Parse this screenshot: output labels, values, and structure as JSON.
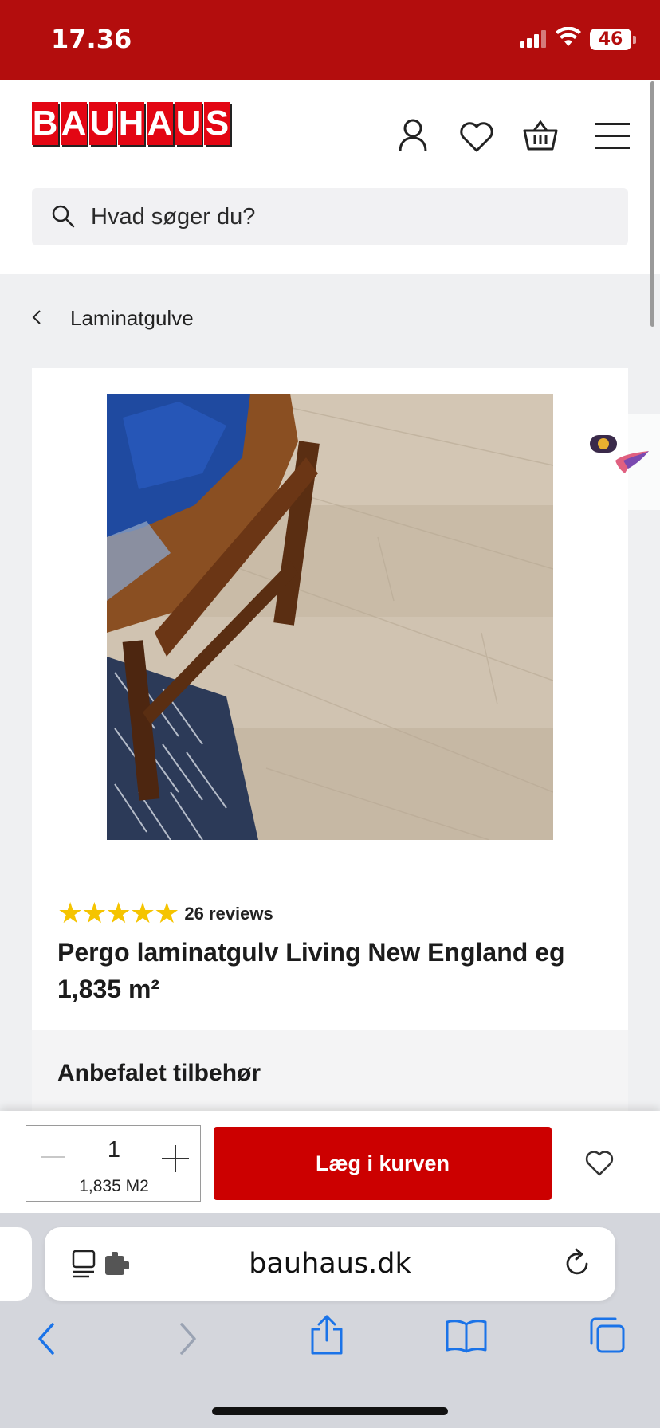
{
  "status_bar": {
    "time": "17.36",
    "battery": "46"
  },
  "header": {
    "logo_text": "BAUHAUS",
    "logo_letters": [
      "B",
      "A",
      "U",
      "H",
      "A",
      "U",
      "S"
    ],
    "icons": [
      "account-icon",
      "heart-icon",
      "basket-icon",
      "menu-icon"
    ],
    "search": {
      "placeholder": "Hvad søger du?"
    }
  },
  "breadcrumb": {
    "back_label": "Laminatgulve"
  },
  "product": {
    "image": "laminate-floor-chair-photo",
    "rating_stars": 5,
    "stars_text": "★★★★★",
    "reviews_text": "26 reviews",
    "title": "Pergo laminatgulv Living New England eg 1,835 m²"
  },
  "accessories": {
    "heading": "Anbefalet tilbehør"
  },
  "cart_bar": {
    "quantity": "1",
    "unit": "1,835 M2",
    "add_button_label": "Læg i kurven"
  },
  "browser": {
    "url": "bauhaus.dk",
    "nav_icons": [
      "back-icon",
      "forward-icon",
      "share-icon",
      "bookmarks-icon",
      "tabs-icon"
    ]
  },
  "colors": {
    "brand_red": "#e30613",
    "status_red": "#b30d0d",
    "button_red": "#cc0000",
    "star_yellow": "#f5c400"
  }
}
